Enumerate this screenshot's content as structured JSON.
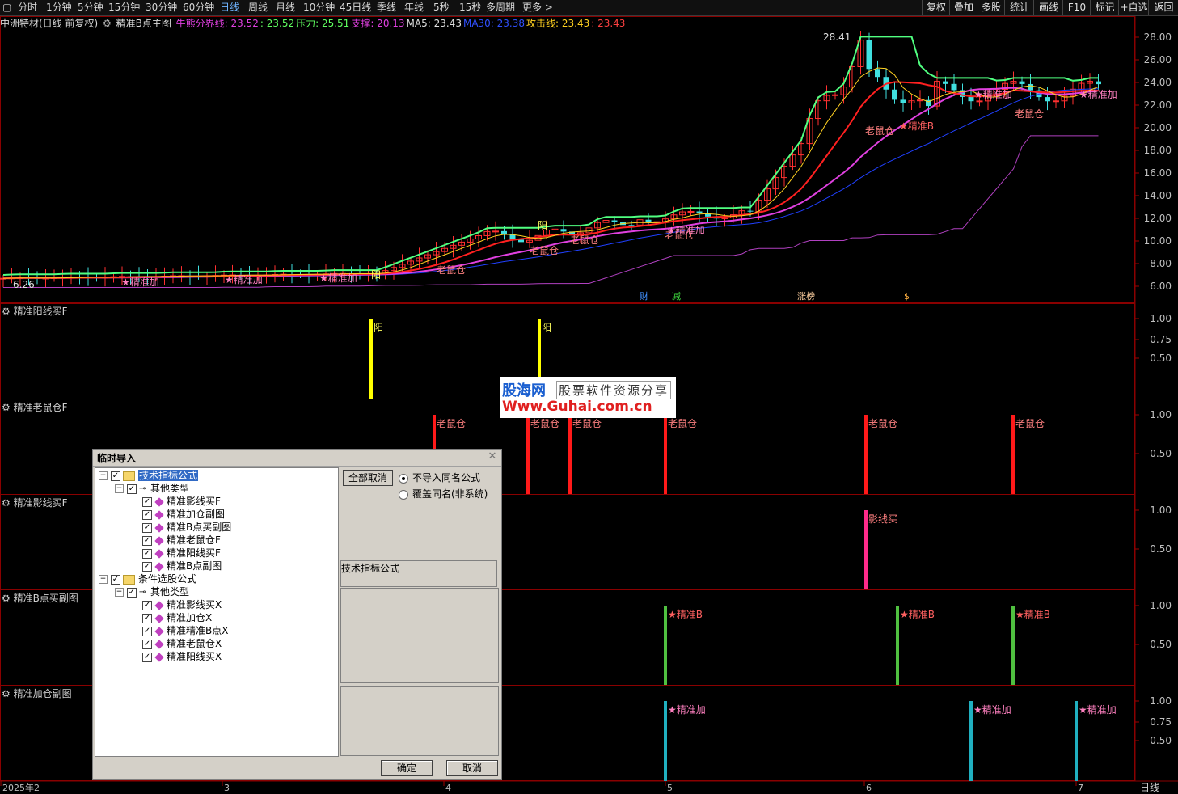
{
  "toolbar": {
    "periods": [
      "分时",
      "1分钟",
      "5分钟",
      "15分钟",
      "30分钟",
      "60分钟",
      "日线",
      "周线",
      "月线",
      "10分钟",
      "45日线",
      "季线",
      "年线",
      "5秒",
      "15秒",
      "多周期",
      "更多 >"
    ],
    "active_period": "日线",
    "right_buttons": [
      "复权",
      "叠加",
      "多股",
      "统计",
      "画线",
      "F10",
      "标记",
      "+自选",
      "返回"
    ]
  },
  "main_info": {
    "stock": "中洲特材(日线 前复权)",
    "indicator": "精准B点主图",
    "items": [
      {
        "text": "牛熊分界线: 23.52",
        "color": "#e040e0"
      },
      {
        "text": ": 23.52",
        "color": "#60ff60"
      },
      {
        "text": "压力: 25.51",
        "color": "#60ff60"
      },
      {
        "text": "支撑: 20.13",
        "color": "#e040e0"
      },
      {
        "text": "MA5: 23.43",
        "color": "#e0e0e0"
      },
      {
        "text": "MA30: 23.38",
        "color": "#3050ff"
      },
      {
        "text": "攻击线: 23.43",
        "color": "#ffd020"
      },
      {
        "text": ": 23.43",
        "color": "#ff4040"
      }
    ]
  },
  "price_axis": [
    "28.00",
    "26.00",
    "24.00",
    "22.00",
    "20.00",
    "18.00",
    "16.00",
    "14.00",
    "12.00",
    "10.00",
    "8.00",
    "6.00"
  ],
  "chart_labels": {
    "high": "28.41",
    "low": "6.26",
    "events": [
      "财",
      "减",
      "涨榜",
      "$"
    ],
    "signals": [
      "老鼠仓",
      "精准加",
      "精准B",
      "阳"
    ]
  },
  "panels": [
    {
      "title": "精准阳线买F",
      "axis": [
        "1.00",
        "0.75",
        "0.50"
      ],
      "label": "阳",
      "color": "#ffff00"
    },
    {
      "title": "精准老鼠仓F",
      "axis": [
        "1.00",
        "0.50"
      ],
      "label": "老鼠仓",
      "color": "#ff1a1a"
    },
    {
      "title": "精准影线买F",
      "axis": [
        "1.00",
        "0.50"
      ],
      "label": "影线买",
      "color": "#ff2a8a"
    },
    {
      "title": "精准B点买副图",
      "axis": [
        "1.00",
        "0.50"
      ],
      "label": "★精准B",
      "color": "#50c040"
    },
    {
      "title": "精准加仓副图",
      "axis": [
        "1.00",
        "0.75",
        "0.50"
      ],
      "label": "★精准加",
      "color": "#20b0c0"
    }
  ],
  "x_axis": [
    "2025年2",
    "3",
    "4",
    "5",
    "6",
    "7"
  ],
  "bottom_right": "日线",
  "dialog": {
    "title": "临时导入",
    "tree": [
      {
        "level": 0,
        "type": "folder",
        "label": "技术指标公式",
        "selected": true
      },
      {
        "level": 1,
        "type": "key",
        "label": "其他类型"
      },
      {
        "level": 2,
        "type": "item",
        "label": "精准影线买F"
      },
      {
        "level": 2,
        "type": "item",
        "label": "精准加仓副图"
      },
      {
        "level": 2,
        "type": "item",
        "label": "精准B点买副图"
      },
      {
        "level": 2,
        "type": "item",
        "label": "精准老鼠仓F"
      },
      {
        "level": 2,
        "type": "item",
        "label": "精准阳线买F"
      },
      {
        "level": 2,
        "type": "item",
        "label": "精准B点副图"
      },
      {
        "level": 0,
        "type": "folder",
        "label": "条件选股公式"
      },
      {
        "level": 1,
        "type": "key",
        "label": "其他类型"
      },
      {
        "level": 2,
        "type": "item",
        "label": "精准影线买X"
      },
      {
        "level": 2,
        "type": "item",
        "label": "精准加仓X"
      },
      {
        "level": 2,
        "type": "item",
        "label": "精准精准B点X"
      },
      {
        "level": 2,
        "type": "item",
        "label": "精准老鼠仓X"
      },
      {
        "level": 2,
        "type": "item",
        "label": "精准阳线买X"
      }
    ],
    "cancel_all": "全部取消",
    "radio1": "不导入同名公式",
    "radio2": "覆盖同名(非系统)",
    "desc": "技术指标公式",
    "ok": "确定",
    "cancel": "取消"
  },
  "watermark": {
    "line1": "股海网",
    "line1b": "股票软件资源分享",
    "line2": "Www.Guhai.com.cn"
  }
}
